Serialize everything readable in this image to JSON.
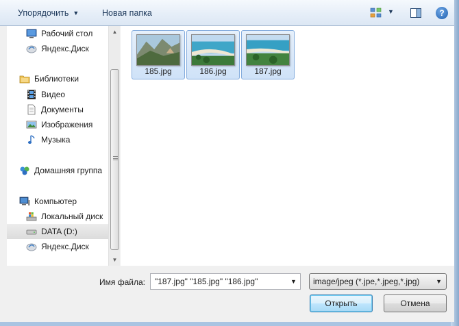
{
  "toolbar": {
    "organize_label": "Упорядочить",
    "new_folder_label": "Новая папка",
    "help_glyph": "?"
  },
  "nav": {
    "items": [
      {
        "label": "Рабочий стол",
        "icon": "desktop-icon"
      },
      {
        "label": "Яндекс.Диск",
        "icon": "yandex-disk-icon"
      },
      {
        "label": "Библиотеки",
        "icon": "libraries-icon"
      },
      {
        "label": "Видео",
        "icon": "video-icon"
      },
      {
        "label": "Документы",
        "icon": "documents-icon"
      },
      {
        "label": "Изображения",
        "icon": "pictures-icon"
      },
      {
        "label": "Музыка",
        "icon": "music-icon"
      },
      {
        "label": "Домашняя группа",
        "icon": "homegroup-icon"
      },
      {
        "label": "Компьютер",
        "icon": "computer-icon"
      },
      {
        "label": "Локальный диск",
        "icon": "local-disk-icon"
      },
      {
        "label": "DATA (D:)",
        "icon": "drive-icon"
      },
      {
        "label": "Яндекс.Диск",
        "icon": "yandex-disk-icon"
      }
    ],
    "selected": "DATA (D:)"
  },
  "files": [
    {
      "name": "185.jpg"
    },
    {
      "name": "186.jpg"
    },
    {
      "name": "187.jpg"
    }
  ],
  "footer": {
    "filename_label": "Имя файла:",
    "filename_value": "\"187.jpg\" \"185.jpg\" \"186.jpg\"",
    "filetype_value": "image/jpeg (*.jpe,*.jpeg,*.jpg)",
    "open_label": "Открыть",
    "cancel_label": "Отмена"
  },
  "colors": {
    "selection_fill": "#cfe2f8",
    "selection_border": "#84acdd",
    "default_button": "#bee6fd"
  }
}
